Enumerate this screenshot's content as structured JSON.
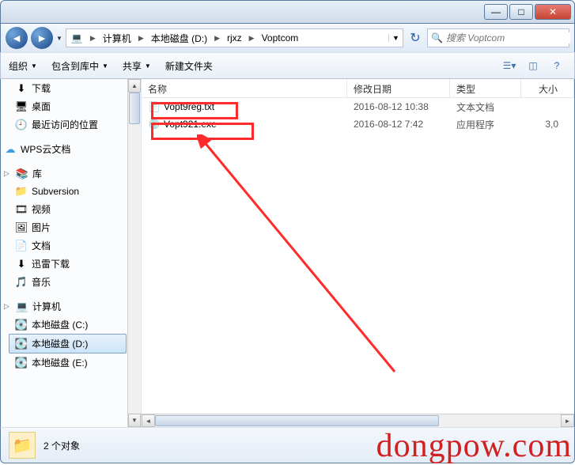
{
  "titlebar": {
    "min": "—",
    "max": "□",
    "close": "✕"
  },
  "nav": {
    "back_glyph": "◄",
    "fwd_glyph": "►",
    "bc_icon": "💻",
    "bc": [
      "计算机",
      "本地磁盘 (D:)",
      "rjxz",
      "Voptcom"
    ],
    "refresh_glyph": "↻",
    "search_placeholder": "搜索 Voptcom",
    "search_glyph": "🔍"
  },
  "toolbar": {
    "organize": "组织",
    "include": "包含到库中",
    "share": "共享",
    "newfolder": "新建文件夹",
    "dd_glyph": "▼"
  },
  "columns": {
    "name": "名称",
    "date": "修改日期",
    "type": "类型",
    "size": "大小"
  },
  "files": [
    {
      "icon": "📄",
      "name": "Vopt9reg.txt",
      "date": "2016-08-12 10:38",
      "type": "文本文档",
      "size": ""
    },
    {
      "icon": "💿",
      "name": "Vopt921.exe",
      "date": "2016-08-12 7:42",
      "type": "应用程序",
      "size": "3,0"
    }
  ],
  "sidebar": {
    "items": [
      {
        "icon": "⬇",
        "label": "下载",
        "color": "#3a7ac8"
      },
      {
        "icon": "🖥",
        "label": "桌面",
        "color": "#4b88cc"
      },
      {
        "icon": "🕘",
        "label": "最近访问的位置",
        "color": "#7a6a40"
      }
    ],
    "wps": {
      "icon": "☁",
      "label": "WPS云文档",
      "color": "#3a9de0"
    },
    "lib": {
      "header": {
        "icon": "📚",
        "label": "库",
        "exp": "▷"
      },
      "items": [
        {
          "icon": "📁",
          "label": "Subversion",
          "color": "#d9b24c"
        },
        {
          "icon": "🎞",
          "label": "视频",
          "color": "#3a7ac8"
        },
        {
          "icon": "🖼",
          "label": "图片",
          "color": "#4a9048"
        },
        {
          "icon": "📄",
          "label": "文档",
          "color": "#c89048"
        },
        {
          "icon": "⬇",
          "label": "迅雷下载",
          "color": "#4a7ab0"
        },
        {
          "icon": "🎵",
          "label": "音乐",
          "color": "#3aa8c8"
        }
      ]
    },
    "computer": {
      "header": {
        "icon": "💻",
        "label": "计算机",
        "exp": "▷"
      },
      "items": [
        {
          "icon": "💽",
          "label": "本地磁盘 (C:)",
          "sel": false
        },
        {
          "icon": "💽",
          "label": "本地磁盘 (D:)",
          "sel": true
        },
        {
          "icon": "💽",
          "label": "本地磁盘 (E:)",
          "sel": false
        }
      ]
    }
  },
  "status": {
    "folder_glyph": "📁",
    "count_text": "2 个对象"
  },
  "watermark": "dongpow.com"
}
